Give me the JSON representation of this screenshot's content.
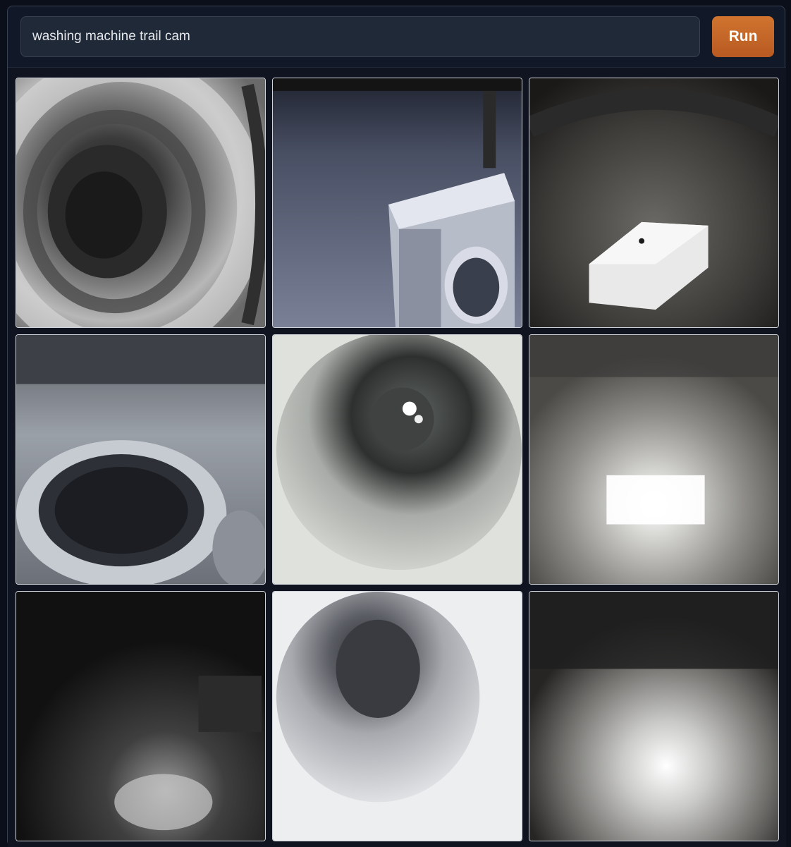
{
  "prompt": {
    "value": "washing machine trail cam"
  },
  "run_button": {
    "label": "Run"
  },
  "gallery": {
    "images": [
      {
        "name": "washer-drum-closeup-1"
      },
      {
        "name": "washer-in-forest-1"
      },
      {
        "name": "white-box-on-ground-1"
      },
      {
        "name": "washer-door-night-1"
      },
      {
        "name": "washer-drum-flash-1"
      },
      {
        "name": "bright-flash-field-1"
      },
      {
        "name": "dark-ground-night-1"
      },
      {
        "name": "washer-drum-white-1"
      },
      {
        "name": "bright-ground-night-1"
      }
    ]
  }
}
